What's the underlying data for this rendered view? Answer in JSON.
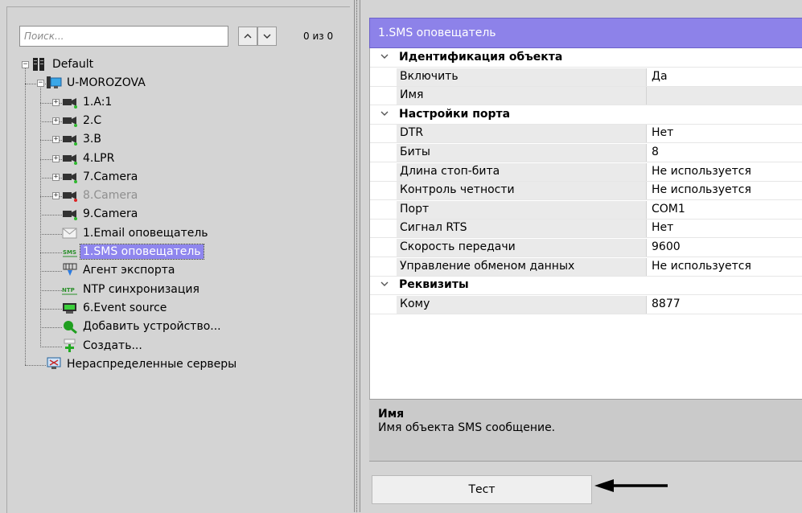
{
  "search": {
    "placeholder": "Поиск...",
    "value": "",
    "result_count": "0 из 0"
  },
  "tree": [
    {
      "label": "Default",
      "icon": "server-group-icon",
      "expander": "−"
    },
    {
      "label": "U-MOROZOVA",
      "icon": "computer-icon",
      "expander": "−"
    },
    {
      "label": "1.A:1",
      "icon": "camera-icon",
      "expander": "+"
    },
    {
      "label": "2.C",
      "icon": "camera-icon",
      "expander": "+"
    },
    {
      "label": "3.B",
      "icon": "camera-icon",
      "expander": "+"
    },
    {
      "label": "4.LPR",
      "icon": "camera-icon",
      "expander": "+"
    },
    {
      "label": "7.Camera",
      "icon": "camera-icon",
      "expander": "+"
    },
    {
      "label": "8.Camera",
      "icon": "camera-icon",
      "expander": "+",
      "disabled": true
    },
    {
      "label": "9.Camera",
      "icon": "camera-icon"
    },
    {
      "label": "1.Email оповещатель",
      "icon": "email-icon"
    },
    {
      "label": "1.SMS оповещатель",
      "icon": "sms-icon",
      "selected": true
    },
    {
      "label": "Агент экспорта",
      "icon": "export-agent-icon"
    },
    {
      "label": "NTP синхронизация",
      "icon": "ntp-icon"
    },
    {
      "label": "6.Event source",
      "icon": "event-source-icon"
    },
    {
      "label": "Добавить устройство...",
      "icon": "add-device-icon"
    },
    {
      "label": "Создать...",
      "icon": "create-icon"
    },
    {
      "label": "Нераспределенные серверы",
      "icon": "unassigned-servers-icon"
    }
  ],
  "object_title": "1.SMS оповещатель",
  "properties": [
    {
      "type": "category",
      "name": "Идентификация объекта"
    },
    {
      "type": "prop",
      "name": "Включить",
      "value": "Да"
    },
    {
      "type": "prop",
      "name": "Имя",
      "value": ""
    },
    {
      "type": "category",
      "name": "Настройки порта"
    },
    {
      "type": "prop",
      "name": "DTR",
      "value": "Нет"
    },
    {
      "type": "prop",
      "name": "Биты",
      "value": "8"
    },
    {
      "type": "prop",
      "name": "Длина стоп-бита",
      "value": "Не используется"
    },
    {
      "type": "prop",
      "name": "Контроль четности",
      "value": "Не используется"
    },
    {
      "type": "prop",
      "name": "Порт",
      "value": "COM1"
    },
    {
      "type": "prop",
      "name": "Сигнал RTS",
      "value": "Нет"
    },
    {
      "type": "prop",
      "name": "Скорость передачи",
      "value": "9600"
    },
    {
      "type": "prop",
      "name": "Управление обменом данных",
      "value": "Не используется"
    },
    {
      "type": "category",
      "name": "Реквизиты"
    },
    {
      "type": "prop",
      "name": "Кому",
      "value": "8877"
    }
  ],
  "description": {
    "title": "Имя",
    "text": "Имя объекта SMS сообщение."
  },
  "test_button_label": "Тест",
  "colors": {
    "selection": "#8f86ee",
    "title_bar": "#8d82e9",
    "panel_bg": "#d4d4d4"
  }
}
